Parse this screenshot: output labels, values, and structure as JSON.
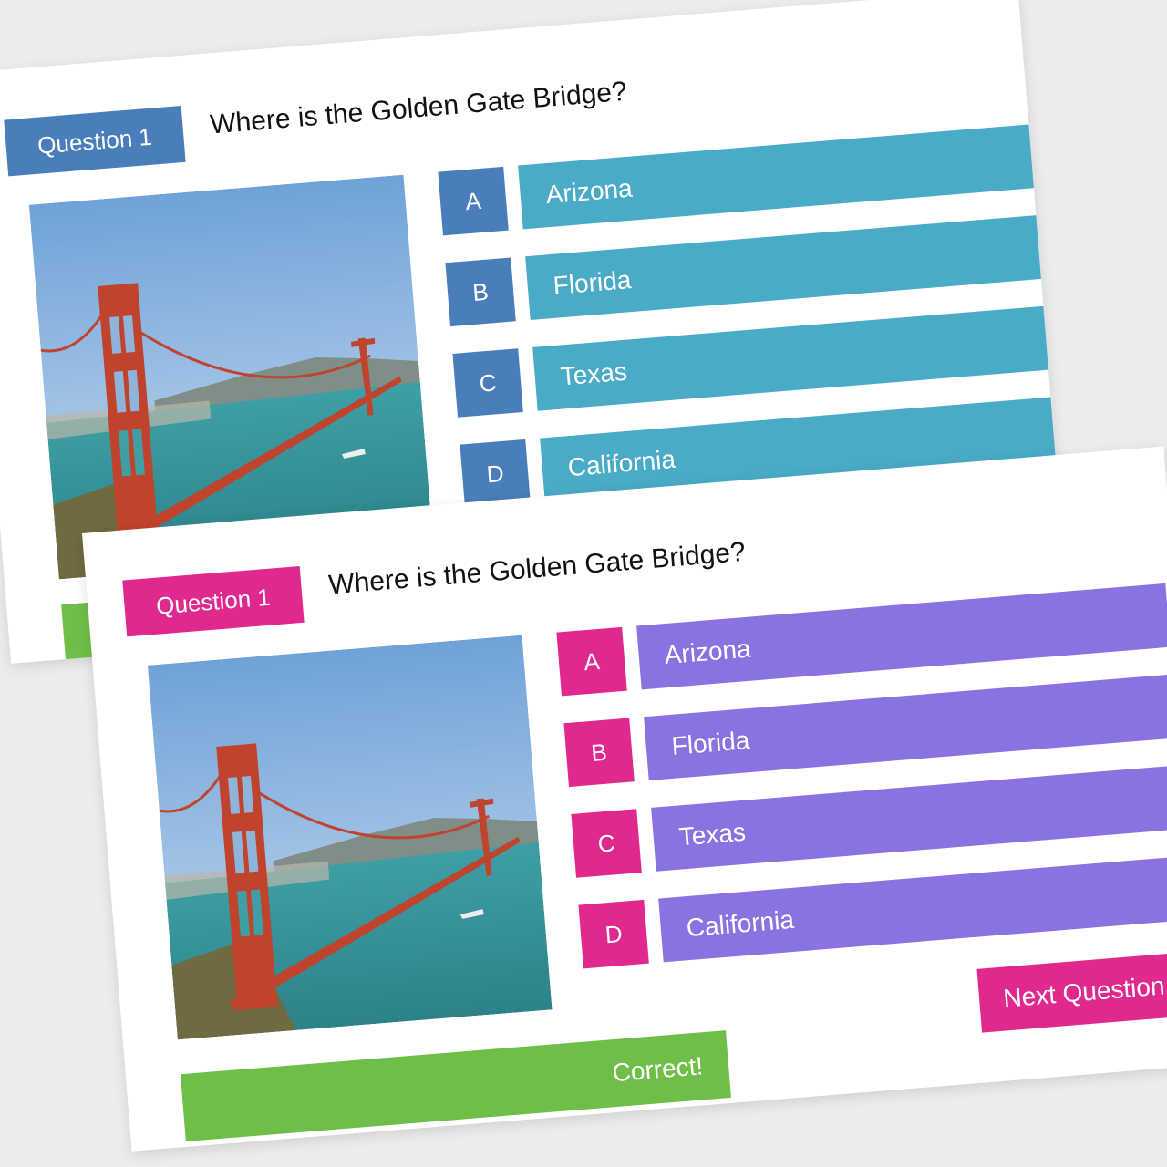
{
  "colors": {
    "back_badge": "#4a7ebb",
    "back_answer": "#4aabc6",
    "front_badge": "#e0298e",
    "front_answer": "#8a72e0",
    "correct_green": "#6fbe4a",
    "sky_top": "#6fa2d8",
    "water": "#3a9aa2",
    "bridge_red": "#c0432e"
  },
  "back_slide": {
    "question_label": "Question 1",
    "question_text": "Where is the Golden Gate Bridge?",
    "answers": [
      {
        "letter": "A",
        "text": "Arizona"
      },
      {
        "letter": "B",
        "text": "Florida"
      },
      {
        "letter": "C",
        "text": "Texas"
      },
      {
        "letter": "D",
        "text": "California"
      }
    ]
  },
  "front_slide": {
    "question_label": "Question 1",
    "question_text": "Where is the Golden Gate Bridge?",
    "answers": [
      {
        "letter": "A",
        "text": "Arizona"
      },
      {
        "letter": "B",
        "text": "Florida"
      },
      {
        "letter": "C",
        "text": "Texas"
      },
      {
        "letter": "D",
        "text": "California"
      }
    ],
    "feedback": "Correct!",
    "next_button": "Next Question"
  },
  "icons": {
    "photo": "golden-gate-bridge-photo"
  }
}
